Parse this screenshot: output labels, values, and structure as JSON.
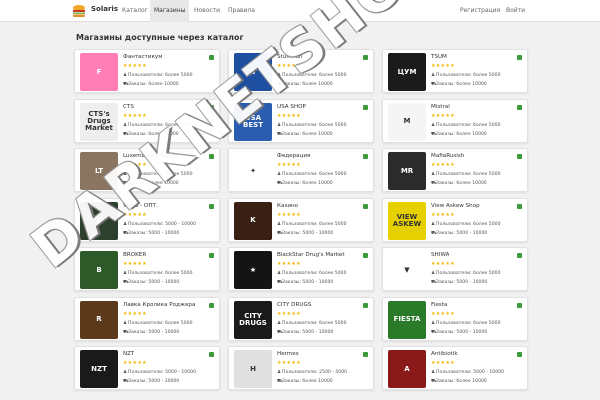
{
  "nav": {
    "brand": "Solaris",
    "links": [
      "Каталог",
      "Магазины",
      "Новости",
      "Правила"
    ],
    "right": [
      "Регистрация",
      "Войти"
    ]
  },
  "watermark": "DARKNETSHOP.COM",
  "heading": "Магазины доступные через каталог",
  "meta_labels": {
    "users": "Пользователи: более 5000",
    "orders": "Заказы: более 10000"
  },
  "shops": [
    {
      "name": "Фантастикум",
      "stars": "★★★★★",
      "users": "Пользователи: более 5000",
      "orders": "Заказы: более 10000",
      "thumb": "F",
      "bg": "#ff7eb6"
    },
    {
      "name": "Stuffman",
      "stars": "★★★★★",
      "users": "Пользователи: более 5000",
      "orders": "Заказы: более 10000",
      "thumb": "S",
      "bg": "#1f4fa0"
    },
    {
      "name": "TSUM",
      "stars": "★★★★★",
      "users": "Пользователи: более 5000",
      "orders": "Заказы: более 10000",
      "thumb": "ЦУМ",
      "bg": "#1b1b1b"
    },
    {
      "name": "CTS",
      "stars": "★★★★★",
      "users": "Пользователи: более 5000",
      "orders": "Заказы: более 10000",
      "thumb": "CTS's Drugs Market",
      "bg": "#eeeeee"
    },
    {
      "name": "USA SHOP",
      "stars": "★★★★★",
      "users": "Пользователи: более 5000",
      "orders": "Заказы: более 10000",
      "thumb": "USA BEST",
      "bg": "#2a5db0"
    },
    {
      "name": "Mistral",
      "stars": "★★★★★",
      "users": "Пользователи: более 5000",
      "orders": "Заказы: более 10000",
      "thumb": "M",
      "bg": "#f5f5f5"
    },
    {
      "name": "Luxembourg Team",
      "stars": "★★★★★",
      "users": "Пользователи: более 5000",
      "orders": "Заказы: более 10000",
      "thumb": "LT",
      "bg": "#8a7560"
    },
    {
      "name": "Федерация",
      "stars": "★★★★★",
      "users": "Пользователи: более 5000",
      "orders": "Заказы: более 10000",
      "thumb": "✦",
      "bg": "#ffffff"
    },
    {
      "name": "MafiaRusish",
      "stars": "★★★★★",
      "users": "Пользователи: более 5000",
      "orders": "Заказы: более 10000",
      "thumb": "MR",
      "bg": "#2b2b2b"
    },
    {
      "name": "Volga - ОПТ.",
      "stars": "★★★★★",
      "users": "Пользователи: 5000 - 10000",
      "orders": "Заказы: 5000 - 10000",
      "thumb": "V",
      "bg": "#2d3f2d"
    },
    {
      "name": "Казино",
      "stars": "★★★★★",
      "users": "Пользователи: более 5000",
      "orders": "Заказы: 5000 - 10000",
      "thumb": "K",
      "bg": "#3a1f14"
    },
    {
      "name": "View Askew Shop",
      "stars": "★★★★★",
      "users": "Пользователи: более 5000",
      "orders": "Заказы: 5000 - 10000",
      "thumb": "VIEW ASKEW",
      "bg": "#e6d000"
    },
    {
      "name": "BROKER",
      "stars": "★★★★★",
      "users": "Пользователи: более 5000",
      "orders": "Заказы: 5000 - 10000",
      "thumb": "B",
      "bg": "#2e5a2a"
    },
    {
      "name": "BlackStar Drug's Market",
      "stars": "★★★★★",
      "users": "Пользователи: более 5000",
      "orders": "Заказы: 5000 - 10000",
      "thumb": "★",
      "bg": "#141414"
    },
    {
      "name": "SHIWA",
      "stars": "★★★★★",
      "users": "Пользователи: более 5000",
      "orders": "Заказы: 5000 - 10000",
      "thumb": "▼",
      "bg": "#ffffff"
    },
    {
      "name": "Лавка Кролика Роджера",
      "stars": "★★★★★",
      "users": "Пользователи: более 5000",
      "orders": "Заказы: 5000 - 10000",
      "thumb": "R",
      "bg": "#5a3a1a"
    },
    {
      "name": "CITY DRUGS",
      "stars": "★★★★★",
      "users": "Пользователи: более 5000",
      "orders": "Заказы: 5000 - 10000",
      "thumb": "CITY DRUGS",
      "bg": "#1a1a1a"
    },
    {
      "name": "Fiesta",
      "stars": "★★★★★",
      "users": "Пользователи: более 5000",
      "orders": "Заказы: 5000 - 10000",
      "thumb": "FIESTA",
      "bg": "#2a7a2a"
    },
    {
      "name": "NZT",
      "stars": "★★★★★",
      "users": "Пользователи: 5000 - 10000",
      "orders": "Заказы: 5000 - 10000",
      "thumb": "NZT",
      "bg": "#1a1a1a"
    },
    {
      "name": "Hermes",
      "stars": "★★★★★",
      "users": "Пользователи: 2500 - 5000",
      "orders": "Заказы: более 10000",
      "thumb": "H",
      "bg": "#e0e0e0"
    },
    {
      "name": "Antibiotik",
      "stars": "★★★★★",
      "users": "Пользователи: 5000 - 10000",
      "orders": "Заказы: более 10000",
      "thumb": "A",
      "bg": "#8a1a1a"
    }
  ],
  "colors": {
    "star": "#f4b400",
    "online": "#3c9a3c",
    "bg": "#f1f1f1"
  }
}
